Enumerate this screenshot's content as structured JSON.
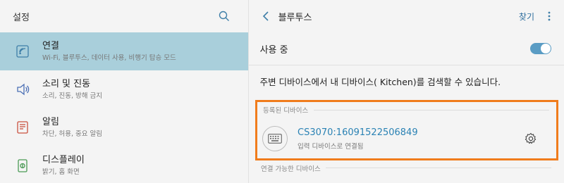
{
  "left": {
    "title": "설정",
    "search_icon": "search-icon",
    "items": [
      {
        "title": "연결",
        "subtitle": "Wi-Fi, 블루투스, 데이터 사용, 비행기 탑승 모드",
        "icon": "connection-icon",
        "active": true
      },
      {
        "title": "소리 및 진동",
        "subtitle": "소리, 진동, 방해 금지",
        "icon": "speaker-icon",
        "active": false
      },
      {
        "title": "알림",
        "subtitle": "차단, 허용, 중요 알림",
        "icon": "notification-icon",
        "active": false
      },
      {
        "title": "디스플레이",
        "subtitle": "밝기, 홈 화면",
        "icon": "display-icon",
        "active": false
      }
    ]
  },
  "right": {
    "title": "블루투스",
    "find_label": "찾기",
    "using_label": "사용 중",
    "toggle_on": true,
    "visibility_text": "주변 디바이스에서 내 디바이스(      Kitchen)를 검색할 수 있습니다.",
    "registered_section": "등록된 디바이스",
    "device": {
      "name": "CS3070:16091522506849",
      "status": "입력 디바이스로 연결됨",
      "icon": "keyboard-icon"
    },
    "available_section": "연결 가능한 디바이스"
  },
  "colors": {
    "accent": "#2a82b4",
    "active_item_bg": "#a9cfdb",
    "highlight_border": "#f07c1c",
    "toggle_on": "#5a9cc4"
  }
}
